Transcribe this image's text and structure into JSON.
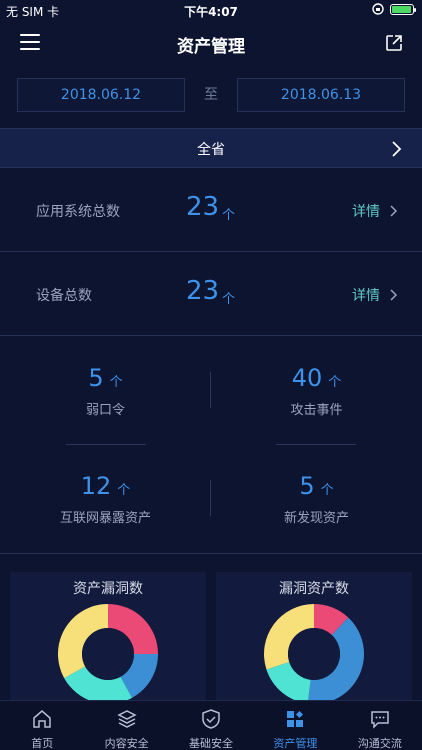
{
  "status_bar": {
    "carrier": "无 SIM 卡",
    "time": "下午4:07",
    "battery_level": 0.95
  },
  "nav": {
    "title": "资产管理"
  },
  "date_range": {
    "start": "2018.06.12",
    "separator": "至",
    "end": "2018.06.13"
  },
  "region": {
    "label": "全省"
  },
  "summary": [
    {
      "label": "应用系统总数",
      "value": "23",
      "unit": "个",
      "link": "详情"
    },
    {
      "label": "设备总数",
      "value": "23",
      "unit": "个",
      "link": "详情"
    }
  ],
  "stats": [
    {
      "value": "5",
      "unit": "个",
      "label": "弱口令"
    },
    {
      "value": "40",
      "unit": "个",
      "label": "攻击事件"
    },
    {
      "value": "12",
      "unit": "个",
      "label": "互联网暴露资产"
    },
    {
      "value": "5",
      "unit": "个",
      "label": "新发现资产"
    }
  ],
  "chart_data": [
    {
      "type": "pie",
      "title": "资产漏洞数",
      "series": [
        {
          "values": [
            25,
            17,
            25,
            33
          ]
        }
      ],
      "colors": [
        "#ea4a75",
        "#3c8fd4",
        "#4fe3d3",
        "#f7df7a"
      ]
    },
    {
      "type": "pie",
      "title": "漏洞资产数",
      "series": [
        {
          "values": [
            12,
            40,
            18,
            30
          ]
        }
      ],
      "colors": [
        "#ea4a75",
        "#3c8fd4",
        "#4fe3d3",
        "#f7df7a"
      ]
    }
  ],
  "tabs": [
    {
      "label": "首页",
      "icon": "home-icon",
      "active": false
    },
    {
      "label": "内容安全",
      "icon": "layers-icon",
      "active": false
    },
    {
      "label": "基础安全",
      "icon": "shield-icon",
      "active": false
    },
    {
      "label": "资产管理",
      "icon": "grid-icon",
      "active": true
    },
    {
      "label": "沟通交流",
      "icon": "chat-icon",
      "active": false
    }
  ],
  "colors": {
    "accent": "#3e92ea",
    "link": "#61c8c4",
    "background": "#0d1430"
  }
}
